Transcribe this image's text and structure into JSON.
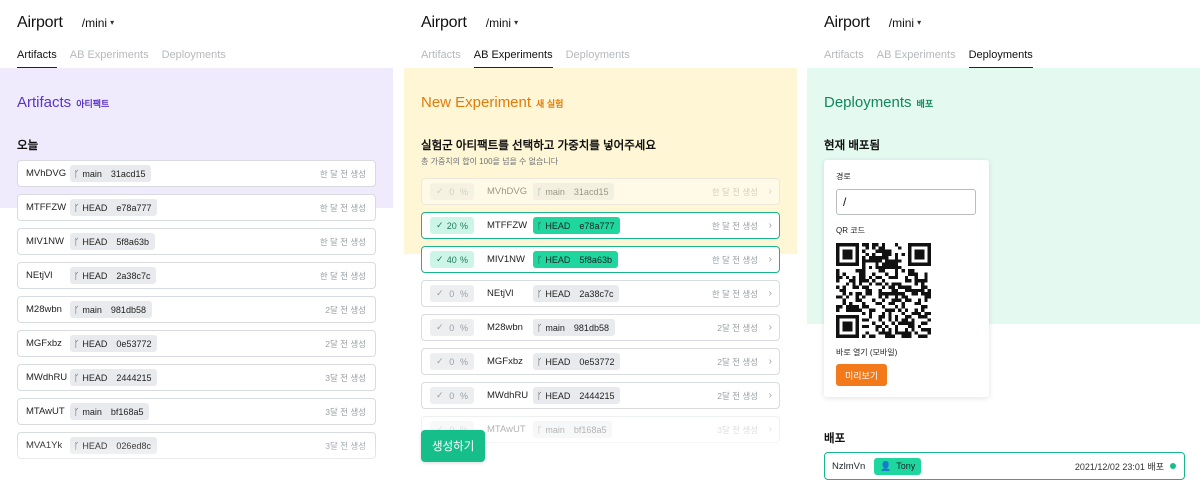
{
  "app_title": "Airport",
  "project": "/mini",
  "tabs": [
    "Artifacts",
    "AB Experiments",
    "Deployments"
  ],
  "artifacts": {
    "title": "Artifacts",
    "title_ko": "아티팩트",
    "group": "오늘",
    "rows": [
      {
        "name": "MVhDVG",
        "branch": "main",
        "hash": "31acd15",
        "time": "한 달 전 생성"
      },
      {
        "name": "MTFFZW",
        "branch": "HEAD",
        "hash": "e78a777",
        "time": "한 달 전 생성"
      },
      {
        "name": "MIV1NW",
        "branch": "HEAD",
        "hash": "5f8a63b",
        "time": "한 달 전 생성"
      },
      {
        "name": "NEtjVl",
        "branch": "HEAD",
        "hash": "2a38c7c",
        "time": "한 달 전 생성"
      },
      {
        "name": "M28wbn",
        "branch": "main",
        "hash": "981db58",
        "time": "2달 전 생성"
      },
      {
        "name": "MGFxbz",
        "branch": "HEAD",
        "hash": "0e53772",
        "time": "2달 전 생성"
      },
      {
        "name": "MWdhRU",
        "branch": "HEAD",
        "hash": "2444215",
        "time": "3달 전 생성"
      },
      {
        "name": "MTAwUT",
        "branch": "main",
        "hash": "bf168a5",
        "time": "3달 전 생성"
      },
      {
        "name": "MVA1Yk",
        "branch": "HEAD",
        "hash": "026ed8c",
        "time": "3달 전 생성"
      }
    ]
  },
  "experiment": {
    "title": "New Experiment",
    "title_ko": "새 실험",
    "heading": "실험군 아티팩트를 선택하고 가중치를 넣어주세요",
    "note": "총 가중치의 합이 100을 넘을 수 없습니다",
    "percent_sign": "%",
    "create_label": "생성하기",
    "rows": [
      {
        "weight": "0",
        "selected": false,
        "faded": true,
        "name": "MVhDVG",
        "branch": "main",
        "hash": "31acd15",
        "time": "한 달 전 생성"
      },
      {
        "weight": "20",
        "selected": true,
        "faded": false,
        "name": "MTFFZW",
        "branch": "HEAD",
        "hash": "e78a777",
        "time": "한 달 전 생성"
      },
      {
        "weight": "40",
        "selected": true,
        "faded": false,
        "name": "MIV1NW",
        "branch": "HEAD",
        "hash": "5f8a63b",
        "time": "한 달 전 생성"
      },
      {
        "weight": "0",
        "selected": false,
        "faded": false,
        "name": "NEtjVl",
        "branch": "HEAD",
        "hash": "2a38c7c",
        "time": "한 달 전 생성"
      },
      {
        "weight": "0",
        "selected": false,
        "faded": false,
        "name": "M28wbn",
        "branch": "main",
        "hash": "981db58",
        "time": "2달 전 생성"
      },
      {
        "weight": "0",
        "selected": false,
        "faded": false,
        "name": "MGFxbz",
        "branch": "HEAD",
        "hash": "0e53772",
        "time": "2달 전 생성"
      },
      {
        "weight": "0",
        "selected": false,
        "faded": false,
        "name": "MWdhRU",
        "branch": "HEAD",
        "hash": "2444215",
        "time": "2달 전 생성"
      },
      {
        "weight": "0",
        "selected": false,
        "faded": true,
        "name": "MTAwUT",
        "branch": "main",
        "hash": "bf168a5",
        "time": "3달 전 생성"
      }
    ]
  },
  "deployments": {
    "title": "Deployments",
    "title_ko": "배포",
    "current_heading": "현재 배포됨",
    "path_label": "경로",
    "path_value": "/",
    "qr_label": "QR 코드",
    "open_label": "바로 열기 (모바일)",
    "preview_label": "미리보기",
    "list_heading": "배포",
    "row": {
      "name": "NzlmVn",
      "user": "Tony",
      "date": "2021/12/02 23:01 배포"
    }
  },
  "colors": {
    "artifacts_accent": "#5b34c7",
    "experiment_accent": "#e27a09",
    "deployments_accent": "#10875c",
    "selected_border": "#17b68a",
    "green_pill": "#1ed69e",
    "preview_button": "#f27a1a"
  },
  "icons": {
    "branch": "git-branch-icon",
    "check": "check-icon",
    "user": "user-icon",
    "chevron": "chevron-right-icon"
  }
}
